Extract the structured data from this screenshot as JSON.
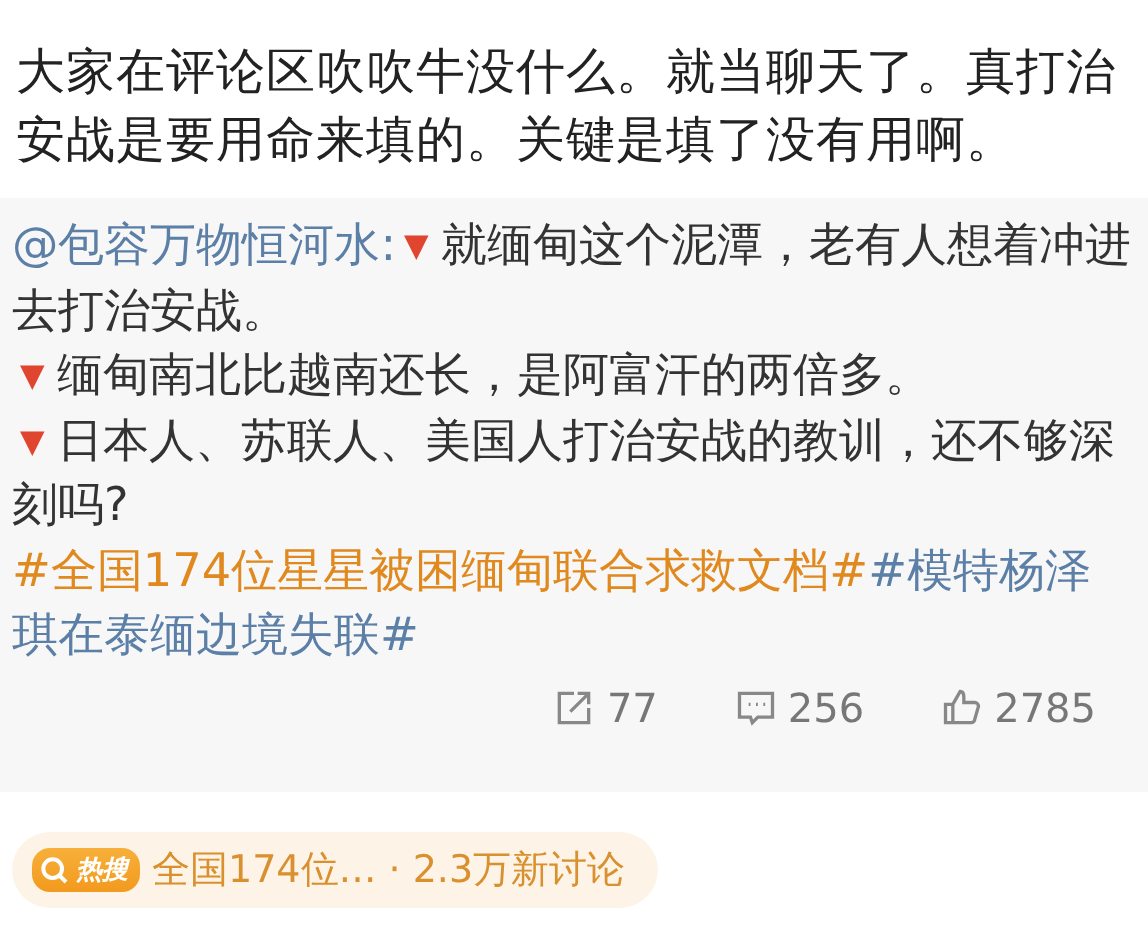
{
  "post": {
    "text": "大家在评论区吹吹牛没什么。就当聊天了。真打治安战是要用命来填的。关键是填了没有用啊。"
  },
  "repost": {
    "author": "@包容万物恒河水",
    "separator": ":",
    "lines": [
      {
        "marker": "▼",
        "text": "就缅甸这个泥潭，老有人想着冲进去打治安战。"
      },
      {
        "marker": "▼",
        "text": "缅甸南北比越南还长，是阿富汗的两倍多。"
      },
      {
        "marker": "▼",
        "text": "日本人、苏联人、美国人打治安战的教训，还不够深刻吗?"
      }
    ],
    "hashtags": [
      {
        "text": "#全国174位星星被困缅甸联合求救文档#",
        "hot": true
      },
      {
        "text": "#模特杨泽琪在泰缅边境失联#",
        "hot": false
      }
    ],
    "stats": [
      {
        "kind": "repost",
        "count": "77"
      },
      {
        "kind": "comment",
        "count": "256"
      },
      {
        "kind": "like",
        "count": "2785"
      }
    ]
  },
  "hot_search": {
    "badge": "热搜",
    "topic": "全国174位…",
    "discussion": "· 2.3万新讨论"
  }
}
